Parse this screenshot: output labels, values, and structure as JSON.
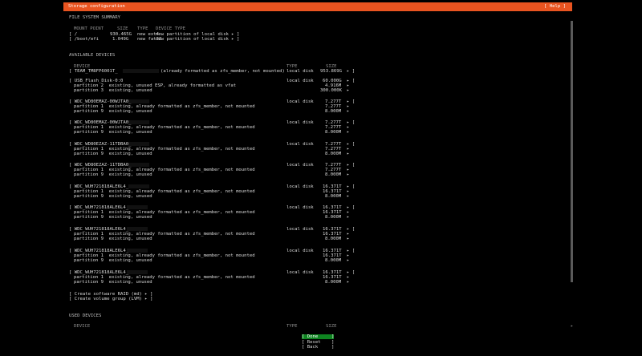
{
  "window": {
    "title": "Storage configuration",
    "help": "[ Help ]"
  },
  "fs_summary": {
    "heading": "FILE SYSTEM SUMMARY",
    "columns": {
      "mount": "MOUNT POINT",
      "size": "SIZE",
      "type": "TYPE",
      "devtype": "DEVICE TYPE"
    },
    "rows": [
      {
        "mount": "[ /",
        "size": "930.465G",
        "type": "new ext4",
        "devtype": "new partition of local disk ▸ ]"
      },
      {
        "mount": "[ /boot/efi",
        "size": "1.049G",
        "type": "new fat32",
        "devtype": "new partition of local disk ▸ ]"
      }
    ]
  },
  "available": {
    "heading": "AVAILABLE DEVICES",
    "columns": {
      "device": "DEVICE",
      "type": "TYPE",
      "size": "SIZE"
    },
    "first": {
      "name": "[ TEAM_TM8FP6001T_",
      "note": "(already formatted as zfs_member, not mounted)",
      "type": "local disk",
      "size": "953.869G",
      "arrow": "▸ ]"
    },
    "usb": {
      "name": "[ USB_Flash_Disk-0:0",
      "type": "local disk",
      "size": "60.000G",
      "arrow": "▸ [",
      "parts": [
        {
          "label": "partition 2  existing, unused ESP, already formatted as vfat",
          "size": "4.916M",
          "arrow": "▸"
        },
        {
          "label": "partition 3  existing, unused",
          "size": "300.000K",
          "arrow": "▸"
        }
      ]
    },
    "disks": [
      {
        "name": "[ WDC_WD80EMAZ-00WJTA0_",
        "type": "local disk",
        "size": "7.277T",
        "arrow": "▸ [",
        "p1": "partition 1  existing, already formatted as zfs_member, not mounted",
        "p1size": "7.277T",
        "p9": "partition 9  existing, unused",
        "p9size": "8.000M"
      },
      {
        "name": "[ WDC_WD80EMAZ-00WJTA0_",
        "type": "local disk",
        "size": "7.277T",
        "arrow": "▸ [",
        "p1": "partition 1  existing, already formatted as zfs_member, not mounted",
        "p1size": "7.277T",
        "p9": "partition 9  existing, unused",
        "p9size": "8.000M"
      },
      {
        "name": "[ WDC_WD80EZAZ-11TDBA0_",
        "type": "local disk",
        "size": "7.277T",
        "arrow": "▸ [",
        "p1": "partition 1  existing, already formatted as zfs_member, not mounted",
        "p1size": "7.277T",
        "p9": "partition 9  existing, unused",
        "p9size": "8.000M"
      },
      {
        "name": "[ WDC_WD80EZAZ-11TDBA0_",
        "type": "local disk",
        "size": "7.277T",
        "arrow": "▸ [",
        "p1": "partition 1  existing, already formatted as zfs_member, not mounted",
        "p1size": "7.277T",
        "p9": "partition 9  existing, unused",
        "p9size": "8.000M"
      },
      {
        "name": "[ WDC_WUH721818ALE6L4_",
        "type": "local disk",
        "size": "16.371T",
        "arrow": "▸ [",
        "p1": "partition 1  existing, already formatted as zfs_member, not mounted",
        "p1size": "16.371T",
        "p9": "partition 9  existing, unused",
        "p9size": "8.000M"
      },
      {
        "name": "[ WDC_WUH721818ALE6L4_",
        "type": "local disk",
        "size": "16.371T",
        "arrow": "▸ [",
        "p1": "partition 1  existing, already formatted as zfs_member, not mounted",
        "p1size": "16.371T",
        "p9": "partition 9  existing, unused",
        "p9size": "8.000M"
      },
      {
        "name": "[ WDC_WUH721818ALE6L4_",
        "type": "local disk",
        "size": "16.371T",
        "arrow": "▸ [",
        "p1": "partition 1  existing, already formatted as zfs_member, not mounted",
        "p1size": "16.371T",
        "p9": "partition 9  existing, unused",
        "p9size": "8.000M"
      },
      {
        "name": "[ WDC_WUH721818ALE6L4_",
        "type": "local disk",
        "size": "16.371T",
        "arrow": "▸ [",
        "p1": "partition 1  existing, already formatted as zfs_member, not mounted",
        "p1size": "16.371T",
        "p9": "partition 9  existing, unused",
        "p9size": "8.000M"
      },
      {
        "name": "[ WDC_WUH721818ALE6L4_",
        "type": "local disk",
        "size": "16.371T",
        "arrow": "▸ [",
        "p1": "partition 1  existing, already formatted as zfs_member, not mounted",
        "p1size": "16.371T",
        "p9": "partition 9  existing, unused",
        "p9size": "8.000M"
      }
    ],
    "actions": [
      "[ Create software RAID (md) ▸ ]",
      "[ Create volume group (LVM) ▸ ]"
    ]
  },
  "used": {
    "heading": "USED DEVICES",
    "columns": {
      "device": "DEVICE",
      "type": "TYPE",
      "size": "SIZE"
    },
    "arrow": "▸"
  },
  "buttons": {
    "done": "[ Done     ]",
    "reset": "[ Reset    ]",
    "back": "[ Back     ]"
  }
}
